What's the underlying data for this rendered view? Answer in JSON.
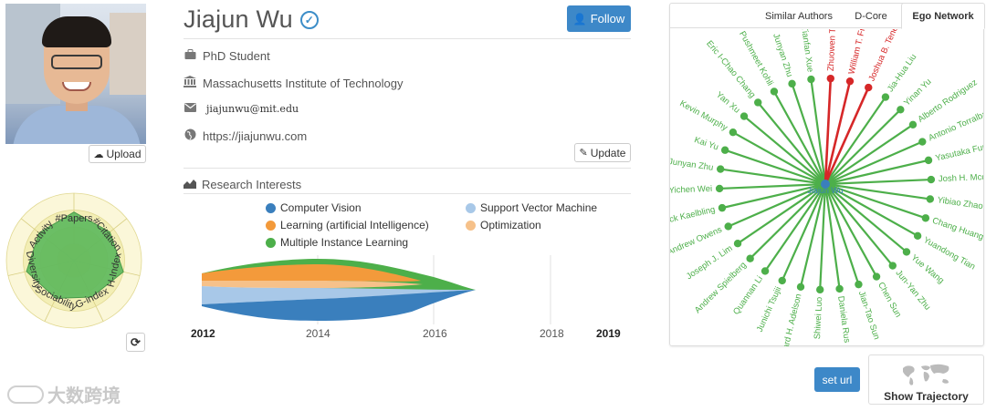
{
  "profile": {
    "name": "Jiajun Wu",
    "title": "PhD Student",
    "organization": "Massachusetts Institute of Technology",
    "email": "jiajunwu@mit.edu",
    "website": "https://jiajunwu.com"
  },
  "buttons": {
    "follow": "Follow",
    "upload": "Upload",
    "update": "Update",
    "set_url": "set url",
    "show_trajectory": "Show Trajectory"
  },
  "radar": {
    "axes": [
      "#Papers",
      "#Citation",
      "H-Index",
      "G-index",
      "Sociability",
      "Diversity",
      "Activity"
    ],
    "values": [
      0.72,
      0.68,
      0.75,
      0.6,
      0.62,
      0.72,
      0.66
    ],
    "fill_color": "#5cb85c"
  },
  "research_interests": {
    "title": "Research Interests",
    "topics": [
      {
        "name": "Computer Vision",
        "color": "#3a7fbd"
      },
      {
        "name": "Support Vector Machine",
        "color": "#a8c8e8"
      },
      {
        "name": "Learning (artificial Intelligence)",
        "color": "#f39a3b"
      },
      {
        "name": "Optimization",
        "color": "#f6c18a"
      },
      {
        "name": "Multiple Instance Learning",
        "color": "#4daf4a"
      }
    ],
    "years": [
      "2012",
      "2014",
      "2016",
      "2018",
      "2019"
    ]
  },
  "ego_network": {
    "tabs": [
      "Similar Authors",
      "D-Core",
      "Ego Network"
    ],
    "active_tab": "Ego Network",
    "center": "Jiajun Wu",
    "edge_color": "#4daf4a",
    "highlight_color": "#d62728",
    "nodes": [
      {
        "name": "Zhuowen Tu",
        "highlight": true
      },
      {
        "name": "William T. Freeman",
        "highlight": true
      },
      {
        "name": "Joshua B. Tenenbaum",
        "highlight": true
      },
      {
        "name": "Jia-Hua Liu",
        "highlight": false
      },
      {
        "name": "Yinan Yu",
        "highlight": false
      },
      {
        "name": "Alberto Rodriguez",
        "highlight": false
      },
      {
        "name": "Antonio Torralba",
        "highlight": false
      },
      {
        "name": "Yasutaka Furukawa",
        "highlight": false
      },
      {
        "name": "Josh H. Mcdermott",
        "highlight": false
      },
      {
        "name": "Yibiao Zhao",
        "highlight": false
      },
      {
        "name": "Chang Huang",
        "highlight": false
      },
      {
        "name": "Yuandong Tian",
        "highlight": false
      },
      {
        "name": "Yue Wang",
        "highlight": false
      },
      {
        "name": "Jun-Yan Zhu",
        "highlight": false
      },
      {
        "name": "Chen Sun",
        "highlight": false
      },
      {
        "name": "Jian-Tao Sun",
        "highlight": false
      },
      {
        "name": "Daniela Rus",
        "highlight": false
      },
      {
        "name": "Shiwei Luo",
        "highlight": false
      },
      {
        "name": "Edward H. Adelson",
        "highlight": false
      },
      {
        "name": "Junichi Tsujii",
        "highlight": false
      },
      {
        "name": "Quannan Li",
        "highlight": false
      },
      {
        "name": "Andrew Spielberg",
        "highlight": false
      },
      {
        "name": "Joseph J. Lim",
        "highlight": false
      },
      {
        "name": "Andrew Owens",
        "highlight": false
      },
      {
        "name": "Pack Kaelbling",
        "highlight": false
      },
      {
        "name": "Yichen Wei",
        "highlight": false
      },
      {
        "name": "Junyan Zhu",
        "highlight": false
      },
      {
        "name": "Kai Yu",
        "highlight": false
      },
      {
        "name": "Kevin Murphy",
        "highlight": false
      },
      {
        "name": "Yan Xu",
        "highlight": false
      },
      {
        "name": "Eric I-Chao Chang",
        "highlight": false
      },
      {
        "name": "Pushmeet Kohli",
        "highlight": false
      },
      {
        "name": "Junyan Zhu",
        "highlight": false
      },
      {
        "name": "Tianfan Xue",
        "highlight": false
      }
    ]
  },
  "watermark": "大数跨境"
}
